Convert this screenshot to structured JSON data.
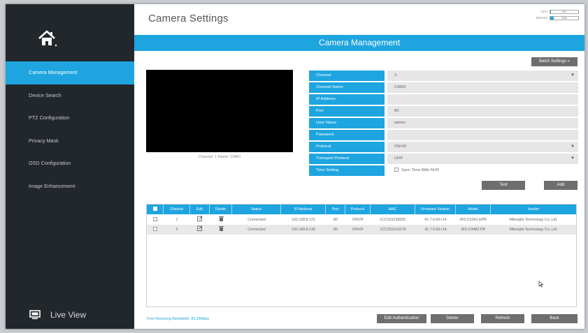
{
  "sidebar": {
    "items": [
      {
        "label": "Camera Management",
        "active": true
      },
      {
        "label": "Device Search",
        "active": false
      },
      {
        "label": "PTZ Configuration",
        "active": false
      },
      {
        "label": "Privacy Mask",
        "active": false
      },
      {
        "label": "OSD Configuration",
        "active": false
      },
      {
        "label": "Image Enhancement",
        "active": false
      }
    ],
    "live_view_label": "Live View",
    "icons": {
      "home": "home-icon",
      "live_view": "monitor-icon"
    }
  },
  "header": {
    "title": "Camera Settings",
    "cpu": {
      "label": "CPU",
      "value": "3%",
      "level": 0.03
    },
    "memory": {
      "label": "Memory",
      "value": "13%",
      "level": 0.13
    }
  },
  "section_title": "Camera Management",
  "batch_settings_label": "Batch Settings",
  "preview": {
    "caption": "Channel: 1    Name: CAM1"
  },
  "form": {
    "channel": {
      "label": "Channel",
      "value": "3"
    },
    "channel_name": {
      "label": "Channel Name",
      "value": "CAM3"
    },
    "ip_address": {
      "label": "IP Address",
      "value": ""
    },
    "port": {
      "label": "Port",
      "value": "80"
    },
    "user_name": {
      "label": "User Name",
      "value": "admin"
    },
    "password": {
      "label": "Password",
      "value": ""
    },
    "protocol": {
      "label": "Protocol",
      "value": "ONVIF"
    },
    "transport_protocol": {
      "label": "Transport Protocol",
      "value": "UDP"
    },
    "time_setting": {
      "label": "Time Setting",
      "value": "Sync Time With NVR"
    }
  },
  "buttons": {
    "test": "Test",
    "add": "Add",
    "edit_authentication": "Edit Authentication",
    "delete": "Delete",
    "refresh": "Refresh",
    "back": "Back"
  },
  "table": {
    "columns": [
      "",
      "Channel",
      "Edit",
      "Delete",
      "Status",
      "IP Address",
      "Port",
      "Protocol",
      "MAC",
      "Firmware Version",
      "Model",
      "Vendor"
    ],
    "rows": [
      {
        "channel": "1",
        "status": "Connected",
        "ip": "192.168.8.121",
        "port": "80",
        "protocol": "ONVIF",
        "mac": "1CC31623683C",
        "firmware": "41.7.0.60-r14",
        "model": "MS-C5361-EPB",
        "vendor": "Milesight Technology Co.,Ltd."
      },
      {
        "channel": "2",
        "status": "Connected",
        "ip": "192.168.8.135",
        "port": "80",
        "protocol": "ONVIF",
        "mac": "1CC316211E78",
        "firmware": "41.7.0.60-r14",
        "model": "MS-C4482-PB",
        "vendor": "Milesight Technology Co.,Ltd."
      }
    ]
  },
  "bandwidth_text": "Free Receiving Bandwidth: 80.25Mbps",
  "colors": {
    "accent": "#1ea5df",
    "sidebar": "#22272c",
    "button": "#6e6e6e"
  }
}
